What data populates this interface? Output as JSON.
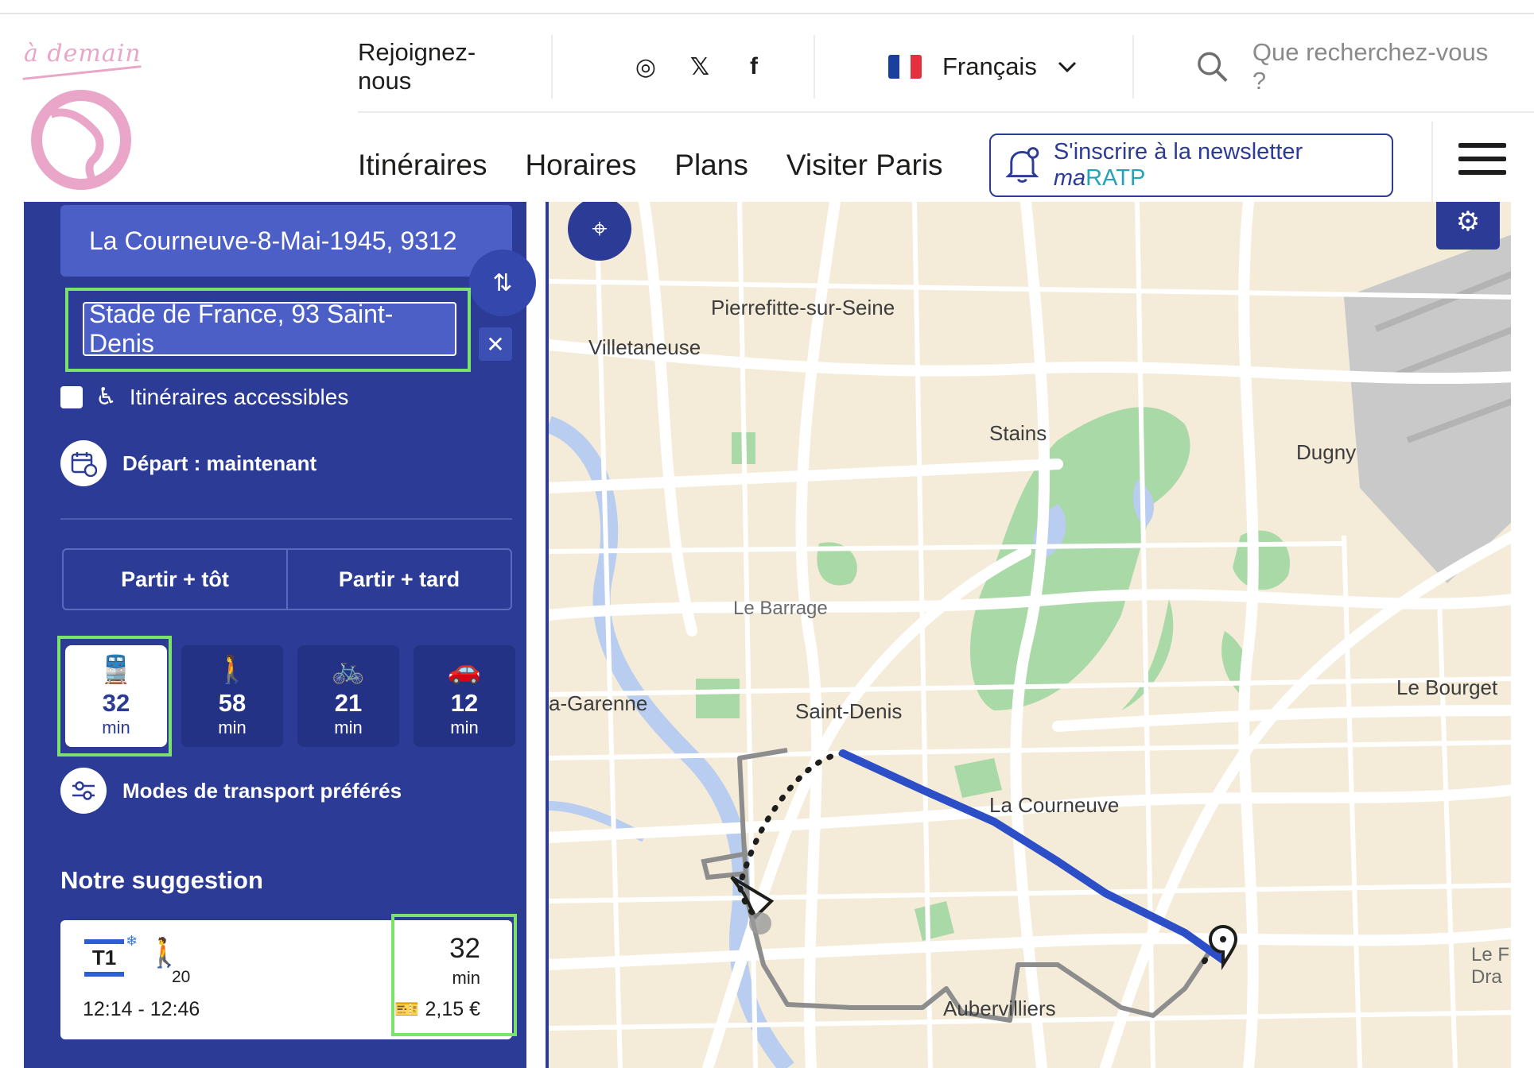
{
  "header": {
    "logo_script": "à demain",
    "join_label": "Rejoignez-nous",
    "socials": [
      "instagram-icon",
      "x-icon",
      "facebook-icon"
    ],
    "social_glyphs": [
      "◎",
      "𝕏",
      "f"
    ],
    "language": "Français",
    "search_placeholder": "Que recherchez-vous ?",
    "nav": [
      "Itinéraires",
      "Horaires",
      "Plans",
      "Visiter Paris"
    ],
    "newsletter_prefix": "S'inscrire à la newsletter ",
    "newsletter_brand_ma": "ma",
    "newsletter_brand_ratp": "RATP"
  },
  "panel": {
    "from": "La Courneuve-8-Mai-1945, 9312",
    "to": "Stade de France, 93 Saint-Denis",
    "accessible_label": "Itinéraires accessibles",
    "departure": "Départ : maintenant",
    "earlier": "Partir + tôt",
    "later": "Partir + tard",
    "modes": [
      {
        "icon": "transit-icon",
        "glyph": "🚆",
        "value": "32",
        "unit": "min",
        "active": true
      },
      {
        "icon": "walk-icon",
        "glyph": "🚶",
        "value": "58",
        "unit": "min",
        "active": false
      },
      {
        "icon": "bike-icon",
        "glyph": "🚲",
        "value": "21",
        "unit": "min",
        "active": false
      },
      {
        "icon": "car-icon",
        "glyph": "🚗",
        "value": "12",
        "unit": "min",
        "active": false
      }
    ],
    "preferred_modes": "Modes de transport préférés",
    "suggestion_title": "Notre suggestion",
    "suggestion": {
      "line": "T1",
      "walk_minutes": "20",
      "hours": "12:14 - 12:46",
      "duration": "32",
      "duration_unit": "min",
      "price": "2,15 €"
    }
  },
  "map": {
    "labels": {
      "pierrefitte": "Pierrefitte-sur-Seine",
      "villetaneuse": "Villetaneuse",
      "stains": "Stains",
      "dugny": "Dugny",
      "le_barrage": "Le Barrage",
      "garenne": "a-Garenne",
      "saint_denis": "Saint-Denis",
      "le_bourget": "Le Bourget",
      "la_courneuve": "La Courneuve",
      "aubervilliers": "Aubervilliers",
      "lef": "Le F",
      "dra": "Dra"
    },
    "colors": {
      "route": "#2c4fc8",
      "land": "#f4ecd9",
      "park": "#a9d9a6",
      "water": "#b8cdef"
    }
  }
}
